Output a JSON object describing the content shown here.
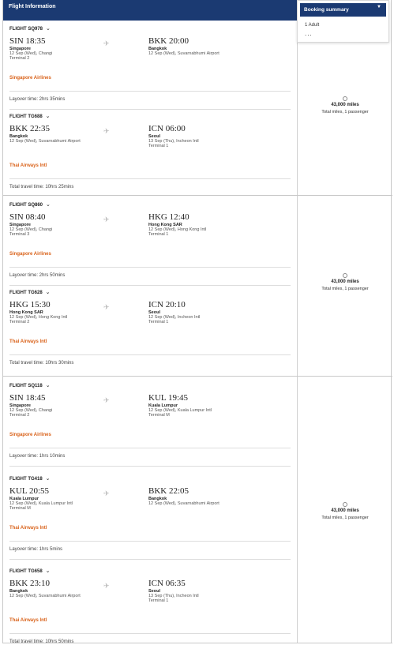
{
  "header": {
    "title": "Flight Information"
  },
  "summary": {
    "title": "Booking summary",
    "passengers": "1 Adult",
    "more": "..."
  },
  "groups": [
    {
      "segments": [
        {
          "flight": "FLIGHT SQ978",
          "dep": {
            "time": "SIN 18:35",
            "city": "Singapore",
            "date": "12 Sep (Wed), Changi",
            "terminal": "Terminal 2"
          },
          "arr": {
            "time": "BKK 20:00",
            "city": "Bangkok",
            "date": "12 Sep (Wed), Suvarnabhumi Airport",
            "terminal": ""
          },
          "airline": "Singapore Airlines",
          "after": "Layover time: 2hrs 35mins"
        },
        {
          "flight": "FLIGHT TG688",
          "dep": {
            "time": "BKK 22:35",
            "city": "Bangkok",
            "date": "12 Sep (Wed), Suvarnabhumi Airport",
            "terminal": ""
          },
          "arr": {
            "time": "ICN 06:00",
            "city": "Seoul",
            "date": "13 Sep (Thu), Incheon Intl",
            "terminal": "Terminal 1"
          },
          "airline": "Thai Airways Intl",
          "after": "Total travel time: 10hrs 25mins"
        }
      ],
      "miles": "43,000 miles",
      "miles_sub": "Total miles, 1 passenger"
    },
    {
      "segments": [
        {
          "flight": "FLIGHT SQ860",
          "dep": {
            "time": "SIN 08:40",
            "city": "Singapore",
            "date": "12 Sep (Wed), Changi",
            "terminal": "Terminal 3"
          },
          "arr": {
            "time": "HKG 12:40",
            "city": "Hong Kong SAR",
            "date": "12 Sep (Wed), Hong Kong Intl",
            "terminal": "Terminal 1"
          },
          "airline": "Singapore Airlines",
          "after": "Layover time: 2hrs 50mins"
        },
        {
          "flight": "FLIGHT TG628",
          "dep": {
            "time": "HKG 15:30",
            "city": "Hong Kong SAR",
            "date": "12 Sep (Wed), Hong Kong Intl",
            "terminal": "Terminal 2"
          },
          "arr": {
            "time": "ICN 20:10",
            "city": "Seoul",
            "date": "12 Sep (Wed), Incheon Intl",
            "terminal": "Terminal 1"
          },
          "airline": "Thai Airways Intl",
          "after": "Total travel time: 10hrs 30mins"
        }
      ],
      "miles": "43,000 miles",
      "miles_sub": "Total miles, 1 passenger"
    },
    {
      "segments": [
        {
          "flight": "FLIGHT SQ118",
          "dep": {
            "time": "SIN 18:45",
            "city": "Singapore",
            "date": "12 Sep (Wed), Changi",
            "terminal": "Terminal 2"
          },
          "arr": {
            "time": "KUL 19:45",
            "city": "Kuala Lumpur",
            "date": "12 Sep (Wed), Kuala Lumpur Intl",
            "terminal": "Terminal M"
          },
          "airline": "Singapore Airlines",
          "after": "Layover time: 1hrs 10mins"
        },
        {
          "flight": "FLIGHT TG418",
          "dep": {
            "time": "KUL 20:55",
            "city": "Kuala Lumpur",
            "date": "12 Sep (Wed), Kuala Lumpur Intl",
            "terminal": "Terminal M"
          },
          "arr": {
            "time": "BKK 22:05",
            "city": "Bangkok",
            "date": "12 Sep (Wed), Suvarnabhumi Airport",
            "terminal": ""
          },
          "airline": "Thai Airways Intl",
          "after": "Layover time: 1hrs 5mins"
        },
        {
          "flight": "FLIGHT TG658",
          "dep": {
            "time": "BKK 23:10",
            "city": "Bangkok",
            "date": "12 Sep (Wed), Suvarnabhumi Airport",
            "terminal": ""
          },
          "arr": {
            "time": "ICN 06:35",
            "city": "Seoul",
            "date": "13 Sep (Thu), Incheon Intl",
            "terminal": "Terminal 1"
          },
          "airline": "Thai Airways Intl",
          "after": "Total travel time: 10hrs 50mins"
        }
      ],
      "miles": "43,000 miles",
      "miles_sub": "Total miles, 1 passenger"
    }
  ],
  "colors": {
    "header": "#1b3a72",
    "airline": "#d9621a"
  }
}
